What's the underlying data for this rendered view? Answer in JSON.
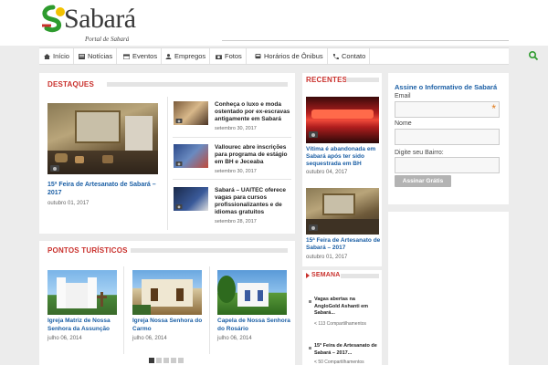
{
  "logo": {
    "mark": "SO",
    "name": "Sabará",
    "subtitle": "Portal de Sabará"
  },
  "nav": {
    "items": [
      {
        "label": "Início",
        "icon": "home-icon"
      },
      {
        "label": "Notícias",
        "icon": "newspaper-icon"
      },
      {
        "label": "Eventos",
        "icon": "calendar-icon"
      },
      {
        "label": "Empregos",
        "icon": "people-icon"
      },
      {
        "label": "Fotos",
        "icon": "camera-icon"
      },
      {
        "label": "Horários de Ônibus",
        "icon": "bus-icon"
      },
      {
        "label": "Contato",
        "icon": "phone-icon"
      }
    ],
    "search_icon": "search-icon"
  },
  "destaques": {
    "title": "DESTAQUES",
    "main": {
      "title": "15ª Feira de Artesanato de Sabará – 2017",
      "date": "outubro 01, 2017"
    },
    "side": [
      {
        "title": "Conheça o luxo e moda ostentado por ex-escravas antigamente em Sabará",
        "date": "setembro 30, 2017"
      },
      {
        "title": "Vallourec abre inscrições para programa de estágio em BH e Jeceaba",
        "date": "setembro 30, 2017"
      },
      {
        "title": "Sabará – UAITEC oferece vagas para cursos profissionalizantes e de idiomas gratuitos",
        "date": "setembro 28, 2017"
      }
    ]
  },
  "pontos": {
    "title": "PONTOS TURÍSTICOS",
    "items": [
      {
        "title": "Igreja Matriz de Nossa Senhora da Assunção",
        "date": "julho 06, 2014"
      },
      {
        "title": "Igreja Nossa Senhora do Carmo",
        "date": "julho 06, 2014"
      },
      {
        "title": "Capela de Nossa Senhora do Rosário",
        "date": "julho 06, 2014"
      }
    ]
  },
  "recentes": {
    "title": "RECENTES",
    "items": [
      {
        "title": "Vítima é abandonada em Sabará após ter sido sequestrada em BH",
        "date": "outubro 04, 2017"
      },
      {
        "title": "15ª Feira de Artesanato de Sabará – 2017",
        "date": "outubro 01, 2017"
      }
    ]
  },
  "semana": {
    "title": "SEMANA",
    "items": [
      {
        "title": "Vagas abertas na AngloGold Ashanti em Sabará...",
        "shares": "113 Compartilhamentos"
      },
      {
        "title": "15ª Feira de Artesanato de Sabará – 2017...",
        "shares": "50 Compartilhamentos"
      }
    ]
  },
  "newsletter": {
    "title": "Assine o Informativo de Sabará",
    "email_label": "Email",
    "name_label": "Nome",
    "bairro_label": "Digite seu Bairro:",
    "button": "Assinar Grátis",
    "required_mark": "*"
  },
  "colors": {
    "accent_red": "#c9302c",
    "link_blue": "#1b5fa5",
    "green": "#2e9b2e",
    "yellow": "#f2c200"
  }
}
